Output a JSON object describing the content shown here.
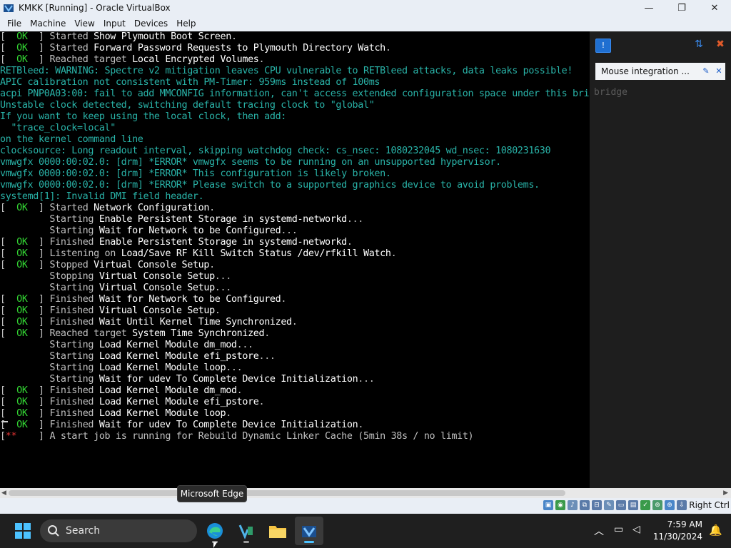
{
  "window": {
    "title": "KMKK [Running] - Oracle VirtualBox",
    "minimize": "—",
    "restore": "❐",
    "close": "✕"
  },
  "menu": [
    "File",
    "Machine",
    "View",
    "Input",
    "Devices",
    "Help"
  ],
  "console": {
    "lines": [
      {
        "t": "status",
        "badge": "OK",
        "pre": "] Started ",
        "hl": "Show Plymouth Boot Screen",
        "post": "."
      },
      {
        "t": "status",
        "badge": "OK",
        "pre": "] Started ",
        "hl": "Forward Password Requests to Plymouth Directory Watch",
        "post": "."
      },
      {
        "t": "status",
        "badge": "OK",
        "pre": "] Reached target ",
        "hl": "Local Encrypted Volumes",
        "post": "."
      },
      {
        "t": "kern",
        "text": "RETBleed: WARNING: Spectre v2 mitigation leaves CPU vulnerable to RETBleed attacks, data leaks possible!"
      },
      {
        "t": "kern",
        "text": "APIC calibration not consistent with PM-Timer: 959ms instead of 100ms"
      },
      {
        "t": "kern",
        "text": "acpi PNP0A03:00: fail to add MMCONFIG information, can't access extended configuration space under this bridge"
      },
      {
        "t": "kern",
        "text": "Unstable clock detected, switching default tracing clock to \"global\""
      },
      {
        "t": "kern",
        "text": "If you want to keep using the local clock, then add:"
      },
      {
        "t": "kern",
        "text": "  \"trace_clock=local\""
      },
      {
        "t": "kern",
        "text": "on the kernel command line"
      },
      {
        "t": "kern",
        "text": "clocksource: Long readout interval, skipping watchdog check: cs_nsec: 1080232045 wd_nsec: 1080231630"
      },
      {
        "t": "kern",
        "text": "vmwgfx 0000:00:02.0: [drm] *ERROR* vmwgfx seems to be running on an unsupported hypervisor."
      },
      {
        "t": "kern",
        "text": "vmwgfx 0000:00:02.0: [drm] *ERROR* This configuration is likely broken."
      },
      {
        "t": "kern",
        "text": "vmwgfx 0000:00:02.0: [drm] *ERROR* Please switch to a supported graphics device to avoid problems."
      },
      {
        "t": "kern",
        "text": "systemd[1]: Invalid DMI field header."
      },
      {
        "t": "status",
        "badge": "OK",
        "pre": "] Started ",
        "hl": "Network Configuration",
        "post": "."
      },
      {
        "t": "plain",
        "pre": "         Starting ",
        "hl": "Enable Persistent Storage in systemd-networkd",
        "post": "..."
      },
      {
        "t": "plain",
        "pre": "         Starting ",
        "hl": "Wait for Network to be Configured",
        "post": "..."
      },
      {
        "t": "status",
        "badge": "OK",
        "pre": "] Finished ",
        "hl": "Enable Persistent Storage in systemd-networkd",
        "post": "."
      },
      {
        "t": "status",
        "badge": "OK",
        "pre": "] Listening on ",
        "hl": "Load/Save RF Kill Switch Status /dev/rfkill Watch",
        "post": "."
      },
      {
        "t": "status",
        "badge": "OK",
        "pre": "] Stopped ",
        "hl": "Virtual Console Setup",
        "post": "."
      },
      {
        "t": "plain",
        "pre": "         Stopping ",
        "hl": "Virtual Console Setup",
        "post": "..."
      },
      {
        "t": "plain",
        "pre": "         Starting ",
        "hl": "Virtual Console Setup",
        "post": "..."
      },
      {
        "t": "status",
        "badge": "OK",
        "pre": "] Finished ",
        "hl": "Wait for Network to be Configured",
        "post": "."
      },
      {
        "t": "status",
        "badge": "OK",
        "pre": "] Finished ",
        "hl": "Virtual Console Setup",
        "post": "."
      },
      {
        "t": "status",
        "badge": "OK",
        "pre": "] Finished ",
        "hl": "Wait Until Kernel Time Synchronized",
        "post": "."
      },
      {
        "t": "status",
        "badge": "OK",
        "pre": "] Reached target ",
        "hl": "System Time Synchronized",
        "post": "."
      },
      {
        "t": "plain",
        "pre": "         Starting ",
        "hl": "Load Kernel Module dm_mod",
        "post": "..."
      },
      {
        "t": "plain",
        "pre": "         Starting ",
        "hl": "Load Kernel Module efi_pstore",
        "post": "..."
      },
      {
        "t": "plain",
        "pre": "         Starting ",
        "hl": "Load Kernel Module loop",
        "post": "..."
      },
      {
        "t": "plain",
        "pre": "         Starting ",
        "hl": "Wait for udev To Complete Device Initialization",
        "post": "..."
      },
      {
        "t": "status",
        "badge": "OK",
        "pre": "] Finished ",
        "hl": "Load Kernel Module dm_mod",
        "post": "."
      },
      {
        "t": "status",
        "badge": "OK",
        "pre": "] Finished ",
        "hl": "Load Kernel Module efi_pstore",
        "post": "."
      },
      {
        "t": "status",
        "badge": "OK",
        "pre": "] Finished ",
        "hl": "Load Kernel Module loop",
        "post": "."
      },
      {
        "t": "status",
        "badge": "OK",
        "pre": "] Finished ",
        "hl": "Wait for udev To Complete Device Initialization",
        "post": "."
      },
      {
        "t": "job",
        "badge": "*",
        "pre": "] A start job is running for Rebuild Dynamic Linker Cache (5min 38s / no limit)"
      }
    ]
  },
  "notifications": {
    "mouse_integration": "Mouse integration ...",
    "ghost_text": "bridge"
  },
  "statusbar": {
    "host_key": "Right Ctrl"
  },
  "tooltip": "Microsoft Edge",
  "taskbar": {
    "search_placeholder": "Search",
    "time": "7:59 AM",
    "date": "11/30/2024"
  },
  "colors": {
    "ok": "#33d633",
    "kernel_text": "#29b3a8",
    "error_star": "#e23333"
  }
}
